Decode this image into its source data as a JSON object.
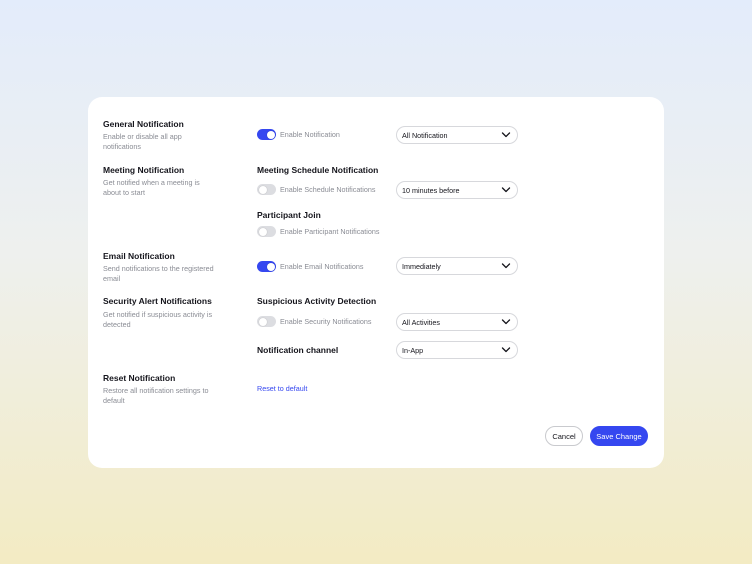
{
  "sections": {
    "general": {
      "title": "General Notification",
      "description": "Enable or disable all app notifications",
      "toggle_label": "Enable Notification",
      "toggle_on": true,
      "select_value": "All Notification"
    },
    "meeting": {
      "title": "Meeting Notification",
      "description": "Get notified when a meeting is about to start",
      "schedule": {
        "title": "Meeting Schedule Notification",
        "toggle_label": "Enable Schedule Notifications",
        "toggle_on": false,
        "select_value": "10 minutes before"
      },
      "participant": {
        "title": "Participant Join",
        "toggle_label": "Enable Participant Notifications",
        "toggle_on": false
      }
    },
    "email": {
      "title": "Email Notification",
      "description": "Send notifications to the registered email",
      "toggle_label": "Enable Email Notifications",
      "toggle_on": true,
      "select_value": "Immediately"
    },
    "security": {
      "title": "Security Alert Notifications",
      "description": "Get notified if suspicious activity is detected",
      "suspicious": {
        "title": "Suspicious Activity Detection",
        "toggle_label": "Enable Security Notifications",
        "toggle_on": false,
        "select_value": "All Activities"
      },
      "channel": {
        "title": "Notification channel",
        "select_value": "In-App"
      }
    },
    "reset": {
      "title": "Reset Notification",
      "description": "Restore all notification settings to default",
      "link_label": "Reset to default"
    }
  },
  "actions": {
    "cancel_label": "Cancel",
    "save_label": "Save Change"
  },
  "icons": {
    "select_arrow": "chevron-down-icon"
  },
  "colors": {
    "accent": "#3547f0",
    "toggle_off": "#dcdde1",
    "muted_text": "#8a8c94"
  }
}
